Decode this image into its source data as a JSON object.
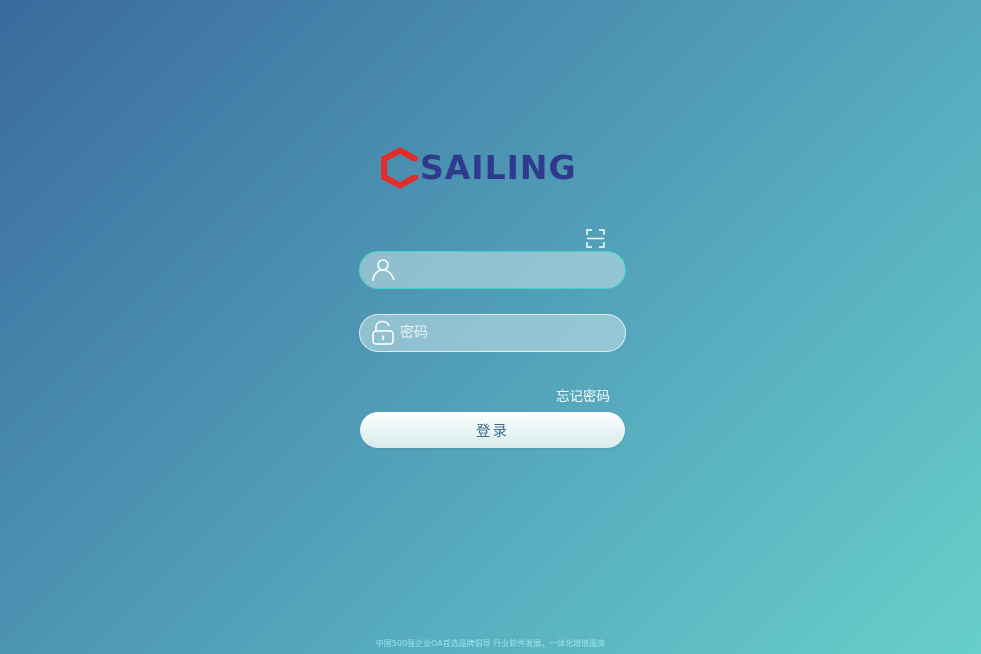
{
  "brand": {
    "logo_text": "SAILING",
    "logo_color": "#2e3a8c",
    "logo_mark_color": "#e22d2d"
  },
  "qr_login": {
    "icon": "qr-scan-icon"
  },
  "login_form": {
    "username": {
      "icon": "user-icon",
      "value": "",
      "placeholder": ""
    },
    "password": {
      "icon": "unlock-icon",
      "value": "",
      "placeholder": "密码"
    },
    "forgot_password_label": "忘记密码",
    "login_button_label": "登录"
  },
  "footer": {
    "text": "中国500强企业OA首选品牌倡导 行业软件发展，一体化增值服务"
  },
  "colors": {
    "accent_border": "#3fd6c6",
    "background_start": "#3a6a9c",
    "background_end": "#67cfca",
    "button_text": "#3d6e86"
  }
}
